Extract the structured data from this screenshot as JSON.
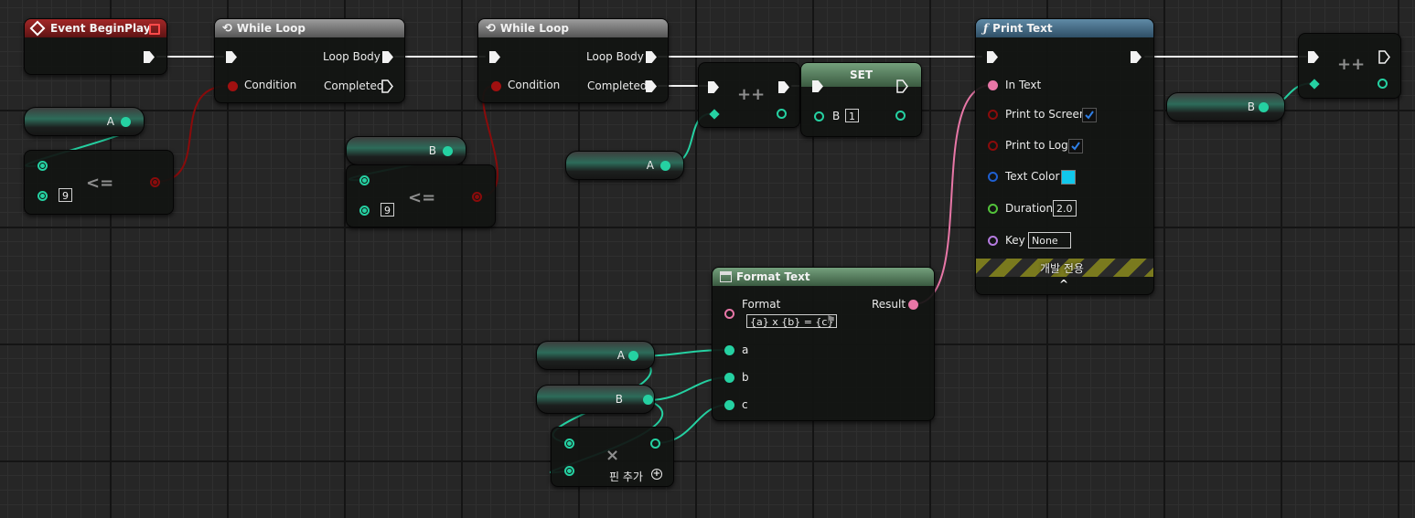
{
  "event_begin_play": {
    "title": "Event BeginPlay"
  },
  "while_loop_1": {
    "title": "While Loop",
    "loop_body": "Loop Body",
    "condition": "Condition",
    "completed": "Completed"
  },
  "while_loop_2": {
    "title": "While Loop",
    "loop_body": "Loop Body",
    "condition": "Condition",
    "completed": "Completed"
  },
  "var_a_1": {
    "name": "A"
  },
  "var_b_1": {
    "name": "B"
  },
  "var_a_2": {
    "name": "A"
  },
  "var_a_3": {
    "name": "A"
  },
  "var_b_2": {
    "name": "B"
  },
  "var_b_3": {
    "name": "B"
  },
  "compare_1": {
    "op": "<=",
    "value": "9"
  },
  "compare_2": {
    "op": "<=",
    "value": "9"
  },
  "increment_1": {
    "op": "++"
  },
  "increment_2": {
    "op": "++"
  },
  "set_node": {
    "title": "SET",
    "var": "B",
    "value": "1"
  },
  "print_text": {
    "title": "Print Text",
    "in_text": "In Text",
    "print_to_screen": "Print to Screen",
    "print_to_screen_checked": true,
    "print_to_log": "Print to Log",
    "print_to_log_checked": true,
    "text_color": "Text Color",
    "text_color_value": "#11c8ec",
    "duration": "Duration",
    "duration_value": "2.0",
    "key": "Key",
    "key_value": "None",
    "dev_only": "개발 전용"
  },
  "format_text": {
    "title": "Format Text",
    "format": "Format",
    "format_value": "{a} x {b} = {c}",
    "result": "Result",
    "pin_a": "a",
    "pin_b": "b",
    "pin_c": "c"
  },
  "multiply": {
    "op": "×",
    "add_pin": "핀 추가"
  },
  "colors": {
    "exec_wire": "#f2f2f2",
    "int_wire": "#25d1a2",
    "bool_wire": "#8a0b0b",
    "text_wire": "#e877a7",
    "event_header": "#a32727",
    "function_header": "#5f8aa6"
  }
}
